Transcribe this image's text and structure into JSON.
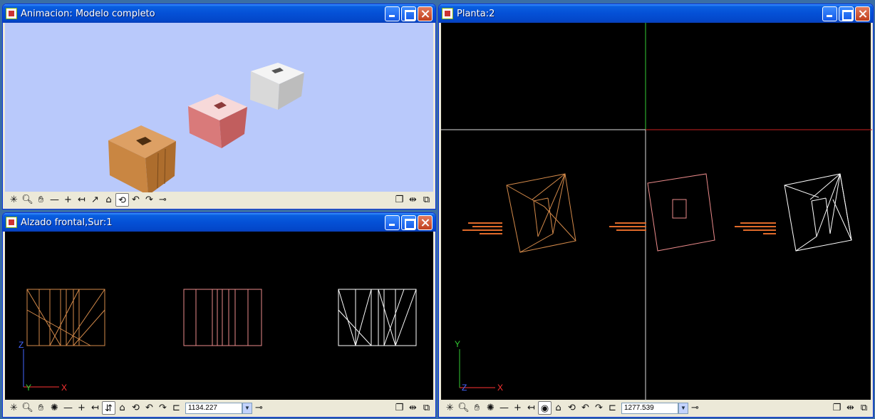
{
  "windows": {
    "animation": {
      "title": "Animacion: Modelo completo"
    },
    "elevation": {
      "title": "Alzado frontal,Sur:1",
      "zoom_value": "1134.227"
    },
    "plan": {
      "title": "Planta:2",
      "zoom_value": "1277.539"
    }
  },
  "axes": {
    "elevation": {
      "vertical": "Z",
      "horizontal": "Y",
      "end": "X"
    },
    "plan": {
      "vertical": "Y",
      "horizontal": "Z",
      "end": "X"
    }
  },
  "icons": [
    "app-icon",
    "minimize-icon",
    "maximize-icon",
    "close-icon",
    "pan-icon",
    "zoom-icon",
    "hand-icon",
    "line-icon",
    "add-icon",
    "undo-icon",
    "redo-icon",
    "open-icon",
    "pin-icon",
    "window-icon",
    "copy-icon"
  ],
  "colors": {
    "titlebar": "#0450d6",
    "sky": "#b9c9fb",
    "object_orange": "#d48a4a",
    "object_pink": "#d97a7a",
    "object_white": "#e5e5e5"
  }
}
